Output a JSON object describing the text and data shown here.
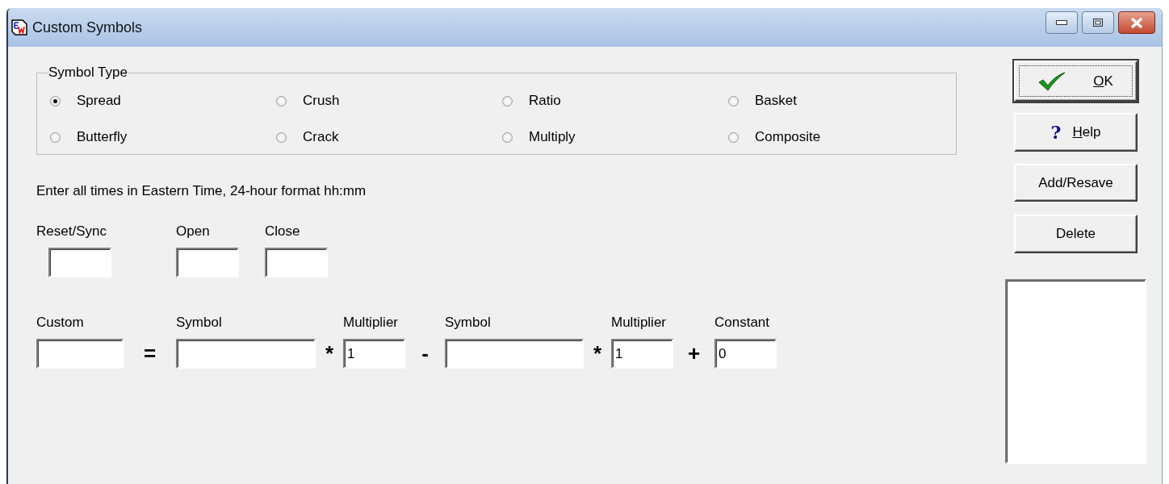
{
  "window": {
    "title": "Custom Symbols"
  },
  "symbol_type": {
    "label": "Symbol Type",
    "options": [
      {
        "label": "Spread",
        "selected": true
      },
      {
        "label": "Crush",
        "selected": false
      },
      {
        "label": "Ratio",
        "selected": false
      },
      {
        "label": "Basket",
        "selected": false
      },
      {
        "label": "Butterfly",
        "selected": false
      },
      {
        "label": "Crack",
        "selected": false
      },
      {
        "label": "Multiply",
        "selected": false
      },
      {
        "label": "Composite",
        "selected": false
      }
    ]
  },
  "instructions": "Enter all times in Eastern Time, 24-hour format  hh:mm",
  "times": [
    {
      "label": "Reset/Sync"
    },
    {
      "label": "Open"
    },
    {
      "label": "Close"
    }
  ],
  "formula": [
    {
      "kind": "field",
      "label": "Custom"
    },
    {
      "kind": "operator",
      "text": "="
    },
    {
      "kind": "field",
      "label": "Symbol"
    },
    {
      "kind": "operator",
      "text": "*"
    },
    {
      "kind": "field",
      "label": "Multiplier",
      "value": "1"
    },
    {
      "kind": "operator",
      "text": "-"
    },
    {
      "kind": "field",
      "label": "Symbol"
    },
    {
      "kind": "operator",
      "text": "*"
    },
    {
      "kind": "field",
      "label": "Multiplier",
      "value": "1"
    },
    {
      "kind": "operator",
      "text": "+"
    },
    {
      "kind": "field",
      "label": "Constant",
      "value": "0"
    }
  ],
  "buttons": [
    {
      "kind": "ok",
      "accel": "O",
      "rest": "K",
      "default": true
    },
    {
      "kind": "help",
      "icon": "?",
      "accel": "H",
      "rest": "elp",
      "default": false
    },
    {
      "kind": "plain",
      "label": "Add/Resave",
      "default": false
    },
    {
      "kind": "plain",
      "label": "Delete",
      "default": false
    }
  ]
}
